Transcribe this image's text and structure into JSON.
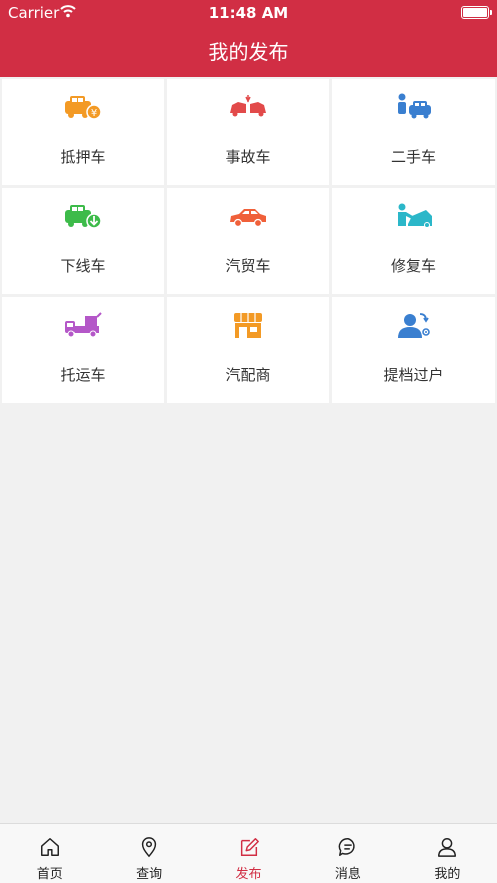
{
  "status_bar": {
    "carrier": "Carrier",
    "time": "11:48 AM"
  },
  "header": {
    "title": "我的发布",
    "bg_color": "#d12e44"
  },
  "grid": [
    {
      "label": "抵押车",
      "icon": "car-yen-icon",
      "color": "#f39a25"
    },
    {
      "label": "事故车",
      "icon": "car-crash-icon",
      "color": "#e24a4a"
    },
    {
      "label": "二手车",
      "icon": "person-car-icon",
      "color": "#3a7fd0"
    },
    {
      "label": "下线车",
      "icon": "car-download-icon",
      "color": "#3dbb4a"
    },
    {
      "label": "汽贸车",
      "icon": "sports-car-icon",
      "color": "#f0603a"
    },
    {
      "label": "修复车",
      "icon": "car-repair-icon",
      "color": "#2bb7c9"
    },
    {
      "label": "托运车",
      "icon": "tow-truck-icon",
      "color": "#b457c8"
    },
    {
      "label": "汽配商",
      "icon": "shop-icon",
      "color": "#f39a25"
    },
    {
      "label": "提档过户",
      "icon": "transfer-person-icon",
      "color": "#3a7fd0"
    }
  ],
  "tabbar": [
    {
      "label": "首页",
      "icon": "home-icon",
      "active": false
    },
    {
      "label": "查询",
      "icon": "location-pin-icon",
      "active": false
    },
    {
      "label": "发布",
      "icon": "edit-icon",
      "active": true
    },
    {
      "label": "消息",
      "icon": "message-icon",
      "active": false
    },
    {
      "label": "我的",
      "icon": "user-icon",
      "active": false
    }
  ]
}
